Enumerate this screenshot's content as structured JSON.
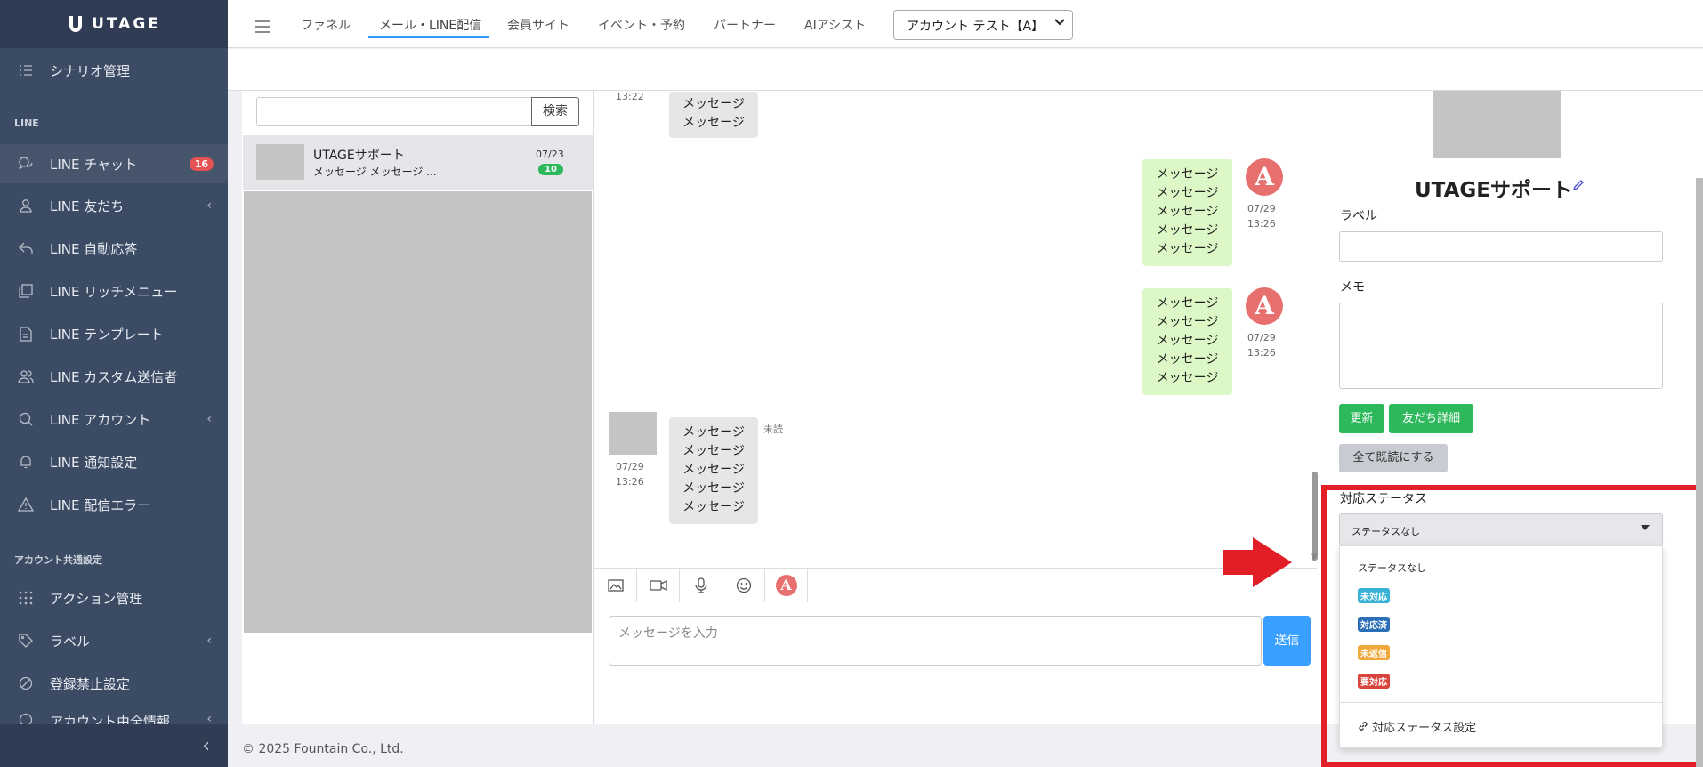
{
  "brand": {
    "name": "UTAGE"
  },
  "sidebar": {
    "items": [
      {
        "label": "シナリオ管理",
        "icon": "list-icon"
      },
      {
        "label": "LINE チャット",
        "icon": "chat-icon",
        "badge": "16",
        "active": true
      },
      {
        "label": "LINE 友だち",
        "icon": "user-icon",
        "chevron": true
      },
      {
        "label": "LINE 自動応答",
        "icon": "reply-icon"
      },
      {
        "label": "LINE リッチメニュー",
        "icon": "copy-icon"
      },
      {
        "label": "LINE テンプレート",
        "icon": "document-icon"
      },
      {
        "label": "LINE カスタム送信者",
        "icon": "people-icon"
      },
      {
        "label": "LINE アカウント",
        "icon": "search-icon",
        "chevron": true
      },
      {
        "label": "LINE 通知設定",
        "icon": "bell-icon"
      },
      {
        "label": "LINE 配信エラー",
        "icon": "warning-icon"
      },
      {
        "label": "アクション管理",
        "icon": "grid-icon"
      },
      {
        "label": "ラベル",
        "icon": "tag-icon",
        "chevron": true
      },
      {
        "label": "登録禁止設定",
        "icon": "ban-icon"
      },
      {
        "label": "アカウント由全情報",
        "icon": "info-icon",
        "chevron": true
      }
    ],
    "section_line": "LINE",
    "section_common": "アカウント共通設定",
    "chevron_glyph": "‹",
    "collapse_glyph": "‹"
  },
  "header": {
    "tabs": [
      "ファネル",
      "メール・LINE配信",
      "会員サイト",
      "イベント・予約",
      "パートナー",
      "AIアシスト"
    ],
    "active_tab": "メール・LINE配信",
    "account_select": "アカウント テスト【A】"
  },
  "friend_list": {
    "search_placeholder": "",
    "search_button": "検索",
    "friends": [
      {
        "name": "UTAGEサポート",
        "last_message": "メッセージ メッセージ ...",
        "date": "07/23",
        "unread": "10"
      }
    ]
  },
  "chat": {
    "messages": [
      {
        "side": "left",
        "lines": [
          "メッセージ",
          "メッセージ"
        ],
        "time": "13:22"
      },
      {
        "side": "right",
        "lines": [
          "メッセージ",
          "メッセージ",
          "メッセージ",
          "メッセージ",
          "メッセージ"
        ],
        "date": "07/29",
        "time": "13:26"
      },
      {
        "side": "right",
        "lines": [
          "メッセージ",
          "メッセージ",
          "メッセージ",
          "メッセージ",
          "メッセージ"
        ],
        "date": "07/29",
        "time": "13:26"
      },
      {
        "side": "left",
        "lines": [
          "メッセージ",
          "メッセージ",
          "メッセージ",
          "メッセージ",
          "メッセージ"
        ],
        "date": "07/29",
        "time": "13:26",
        "status": "未読"
      }
    ],
    "avatar_letter": "A",
    "toolbar_icons": [
      "image-icon",
      "video-icon",
      "mic-icon",
      "emoji-icon",
      "utage-avatar-icon"
    ],
    "input_placeholder": "メッセージを入力",
    "send_label": "送信"
  },
  "profile": {
    "name": "UTAGEサポート",
    "label_title": "ラベル",
    "memo_title": "メモ",
    "update_button": "更新",
    "friend_detail_button": "友だち詳細",
    "mark_all_read_button": "全て既読にする",
    "status_title": "対応ステータス",
    "status_selected": "ステータスなし",
    "status_options": [
      {
        "label": "ステータスなし",
        "color": ""
      },
      {
        "label": "未対応",
        "color": "#39b2d6"
      },
      {
        "label": "対応済",
        "color": "#2a6fb8"
      },
      {
        "label": "未返信",
        "color": "#f0a83a"
      },
      {
        "label": "要対応",
        "color": "#d9453d"
      }
    ],
    "status_settings_link": "対応ステータス設定"
  },
  "footer": {
    "copyright": "© 2025 Fountain Co., Ltd."
  },
  "colors": {
    "sidebar": "#3c4b64",
    "accent": "#3399ff",
    "success": "#2eb85c",
    "highlight": "#e21f26"
  }
}
